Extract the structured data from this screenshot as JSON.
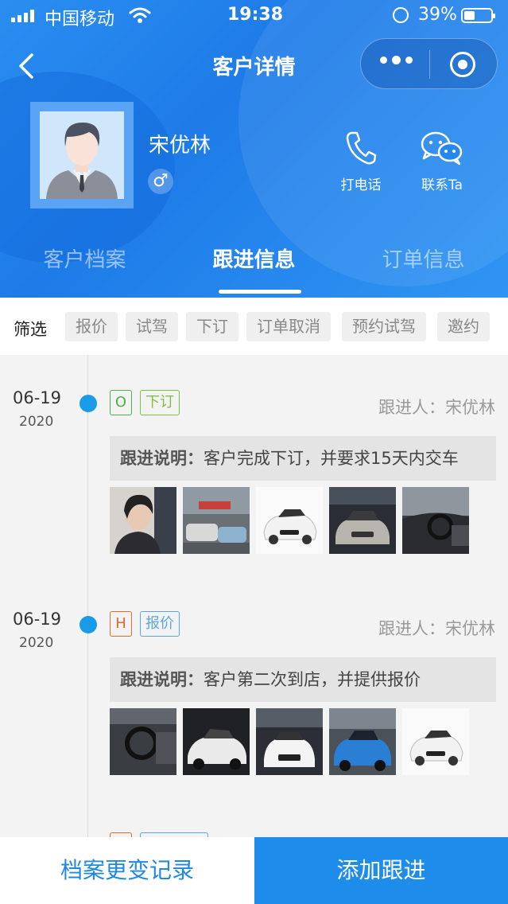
{
  "status_bar": {
    "carrier": "中国移动",
    "time": "19:38",
    "battery": "39%"
  },
  "nav": {
    "title": "客户详情"
  },
  "customer": {
    "name": "宋优林",
    "gender_symbol": "♂",
    "actions": {
      "call_label": "打电话",
      "contact_label": "联系Ta"
    }
  },
  "tabs": [
    {
      "label": "客户档案",
      "active": false
    },
    {
      "label": "跟进信息",
      "active": true
    },
    {
      "label": "订单信息",
      "active": false
    }
  ],
  "filter": {
    "label": "筛选",
    "chips": [
      "报价",
      "试驾",
      "下订",
      "订单取消",
      "预约试驾",
      "邀约"
    ]
  },
  "entries": [
    {
      "date": "06-19",
      "year": "2020",
      "level": "O",
      "level_color": "#4caf50",
      "type": "下订",
      "type_color": "#7cc142",
      "follower": "跟进人：宋优林",
      "note_label": "跟进说明：",
      "note_text": "客户完成下订，并要求15天内交车",
      "photos": [
        "portrait",
        "showroom-street",
        "white-car",
        "silver-car",
        "car-interior"
      ]
    },
    {
      "date": "06-19",
      "year": "2020",
      "level": "H",
      "level_color": "#e8662a",
      "type": "报价",
      "type_color": "#5aa6dc",
      "follower": "跟进人：宋优林",
      "note_label": "跟进说明：",
      "note_text": "客户第二次到店，并提供报价",
      "photos": [
        "car-interior",
        "white-car-dark",
        "white-car-front",
        "blue-car",
        "white-car"
      ]
    }
  ],
  "bottom": {
    "history_label": "档案更变记录",
    "add_label": "添加跟进"
  }
}
